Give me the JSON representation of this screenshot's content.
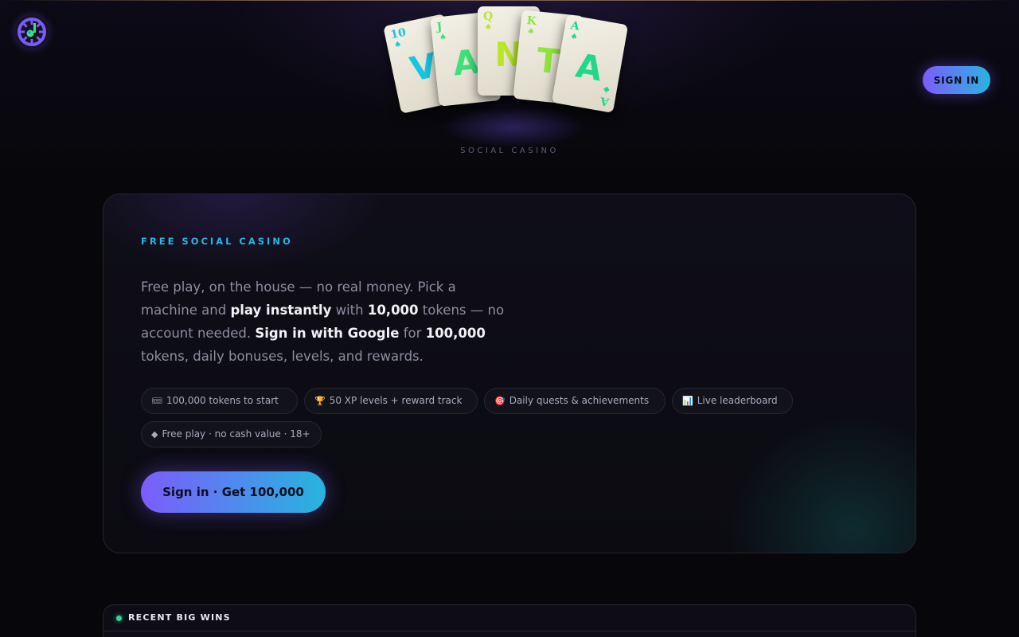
{
  "brand": {
    "logo_icon": "roulette-wheel-icon",
    "cards": [
      {
        "rank": "10",
        "suit": "♠",
        "letter": "V",
        "color": "#16c6e0"
      },
      {
        "rank": "J",
        "suit": "♠",
        "letter": "A",
        "color": "#3ee07a"
      },
      {
        "rank": "Q",
        "suit": "♠",
        "letter": "N",
        "color": "#b8e62a"
      },
      {
        "rank": "K",
        "suit": "♠",
        "letter": "T",
        "color": "#8ee63a"
      },
      {
        "rank": "A",
        "suit": "♠",
        "letter": "A",
        "color": "#20d88a"
      }
    ],
    "subtitle": "SOCIAL CASINO"
  },
  "header": {
    "signin_label": "SIGN IN"
  },
  "hero": {
    "eyebrow": "FREE SOCIAL CASINO",
    "lead": {
      "p1": "Free play, on the house — no real money. Pick a machine and ",
      "b1": "play instantly",
      "p2": " with ",
      "b2": "10,000",
      "p3": " tokens — no account needed. ",
      "b3": "Sign in with Google",
      "p4": " for ",
      "b4": "100,000",
      "p5": " tokens, daily bonuses, levels, and rewards."
    },
    "chips": [
      {
        "icon": "🎟",
        "icon_name": "ticket-icon",
        "label": "100,000 tokens to start"
      },
      {
        "icon": "🏆",
        "icon_name": "trophy-icon",
        "label": "50 XP levels + reward track"
      },
      {
        "icon": "🎯",
        "icon_name": "target-icon",
        "label": "Daily quests & achievements"
      },
      {
        "icon": "📊",
        "icon_name": "chart-icon",
        "label": "Live leaderboard"
      },
      {
        "icon": "◆",
        "icon_name": "diamond-icon",
        "label": "Free play · no cash value · 18+"
      }
    ],
    "cta_label": "Sign in · Get 100,000"
  },
  "recent_wins": {
    "title": "RECENT BIG WINS"
  },
  "colors": {
    "accent_purple": "#7c5cfc",
    "accent_cyan": "#26b5de",
    "eyebrow": "#25b6e2",
    "live_dot": "#34d399"
  }
}
